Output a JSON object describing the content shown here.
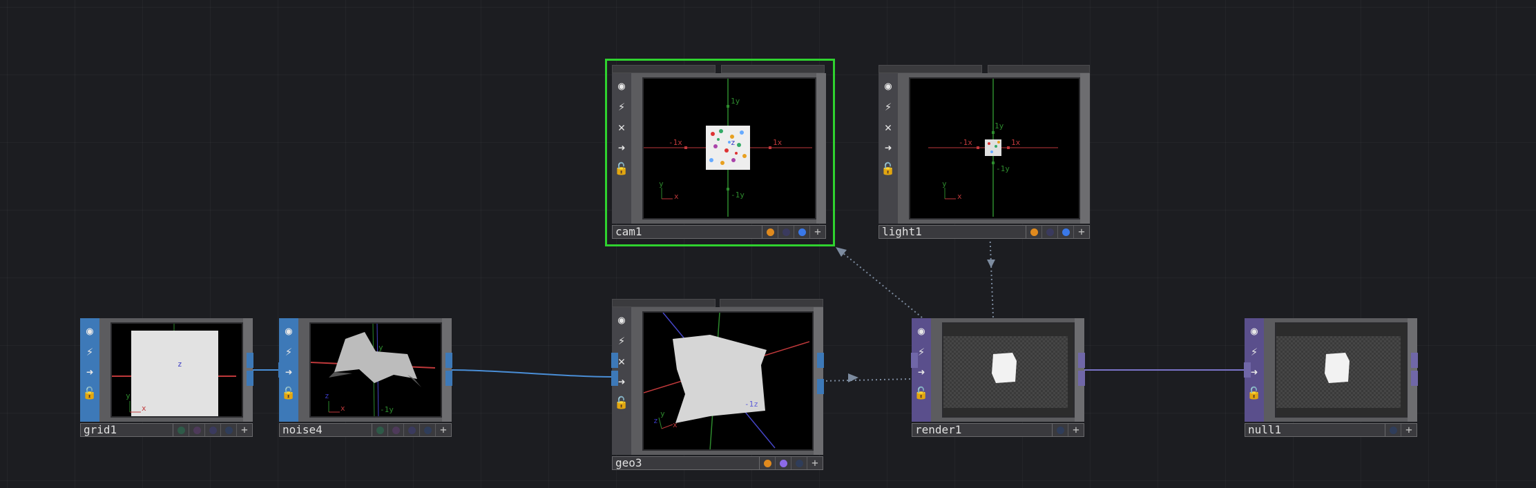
{
  "nodes": {
    "grid1": {
      "name": "grid1"
    },
    "noise4": {
      "name": "noise4"
    },
    "geo3": {
      "name": "geo3"
    },
    "cam1": {
      "name": "cam1"
    },
    "light1": {
      "name": "light1"
    },
    "render1": {
      "name": "render1"
    },
    "null1": {
      "name": "null1"
    }
  },
  "viewer_labels": {
    "grid1": {
      "z": "z",
      "x": "x",
      "y": "y"
    },
    "noise4": {
      "y": "y",
      "neg_y": "-1y",
      "x": "x",
      "z": "z"
    },
    "geo3": {
      "neg_z": "-1z",
      "z": "z",
      "x": "x",
      "y": "y"
    },
    "cam1": {
      "y1": "1y",
      "neg_y": "-1y",
      "x1": "1x",
      "neg_x": "-1x",
      "z": "z",
      "ax_y": "y",
      "ax_x": "x"
    },
    "light1": {
      "y1": "1y",
      "neg_y": "-1y",
      "x1": "1x",
      "neg_x": "-1x",
      "ax_y": "y",
      "ax_x": "x"
    }
  },
  "colors": {
    "selection": "#2fd22f",
    "sop_sidebar": "#3d79b8",
    "top_connector": "#7067a8",
    "wire_sop": "#4a8fd8",
    "wire_top": "#7b74c9",
    "wire_ref": "#7d8ca0",
    "flag_orange": "#e08a1e",
    "flag_blue": "#3a78e8",
    "flag_purple": "#8d6ae8"
  },
  "icons": [
    "viewer-icon",
    "bypass-icon",
    "lock-icon",
    "cook-icon",
    "clone-icon"
  ]
}
